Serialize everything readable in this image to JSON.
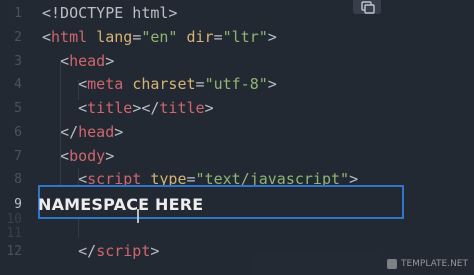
{
  "editor": {
    "lines": [
      {
        "num": "1",
        "parts": [
          [
            "punct",
            "<!DOCTYPE html>"
          ]
        ]
      },
      {
        "num": "2",
        "parts": [
          [
            "punct",
            "<"
          ],
          [
            "tag",
            "html"
          ],
          [
            "punct",
            " "
          ],
          [
            "attr",
            "lang"
          ],
          [
            "punct",
            "="
          ],
          [
            "str",
            "\"en\""
          ],
          [
            "punct",
            " "
          ],
          [
            "attr",
            "dir"
          ],
          [
            "punct",
            "="
          ],
          [
            "str",
            "\"ltr\""
          ],
          [
            "punct",
            ">"
          ]
        ]
      },
      {
        "num": "3",
        "parts": [
          [
            "punct",
            "  <"
          ],
          [
            "tag",
            "head"
          ],
          [
            "punct",
            ">"
          ]
        ]
      },
      {
        "num": "4",
        "parts": [
          [
            "punct",
            "    <"
          ],
          [
            "tag",
            "meta"
          ],
          [
            "punct",
            " "
          ],
          [
            "attr",
            "charset"
          ],
          [
            "punct",
            "="
          ],
          [
            "str",
            "\"utf-8\""
          ],
          [
            "punct",
            ">"
          ]
        ]
      },
      {
        "num": "5",
        "parts": [
          [
            "punct",
            "    <"
          ],
          [
            "tag",
            "title"
          ],
          [
            "punct",
            "></"
          ],
          [
            "tag",
            "title"
          ],
          [
            "punct",
            ">"
          ]
        ]
      },
      {
        "num": "6",
        "parts": [
          [
            "punct",
            "  </"
          ],
          [
            "tag",
            "head"
          ],
          [
            "punct",
            ">"
          ]
        ]
      },
      {
        "num": "7",
        "parts": [
          [
            "punct",
            "  <"
          ],
          [
            "tag",
            "body"
          ],
          [
            "punct",
            ">"
          ]
        ]
      },
      {
        "num": "8",
        "parts": [
          [
            "punct",
            "    <"
          ],
          [
            "tag",
            "script"
          ],
          [
            "punct",
            " "
          ],
          [
            "attr",
            "type"
          ],
          [
            "punct",
            "="
          ],
          [
            "str",
            "\"text/javascript\""
          ],
          [
            "punct",
            ">"
          ]
        ]
      },
      {
        "num": "9",
        "parts": []
      },
      {
        "num": "10",
        "parts": []
      },
      {
        "num": "11",
        "parts": []
      },
      {
        "num": "12",
        "parts": [
          [
            "punct",
            "    </"
          ],
          [
            "tag",
            "script"
          ],
          [
            "punct",
            ">"
          ]
        ]
      }
    ],
    "highlight_text": "NAMESPACE HERE",
    "colors": {
      "background": "#242b34",
      "tag": "#e06c75",
      "attribute": "#e5c07b",
      "string": "#98c379",
      "highlight_border": "#2f7ed8"
    }
  },
  "watermark": {
    "text": "TEMPLATE.NET"
  }
}
